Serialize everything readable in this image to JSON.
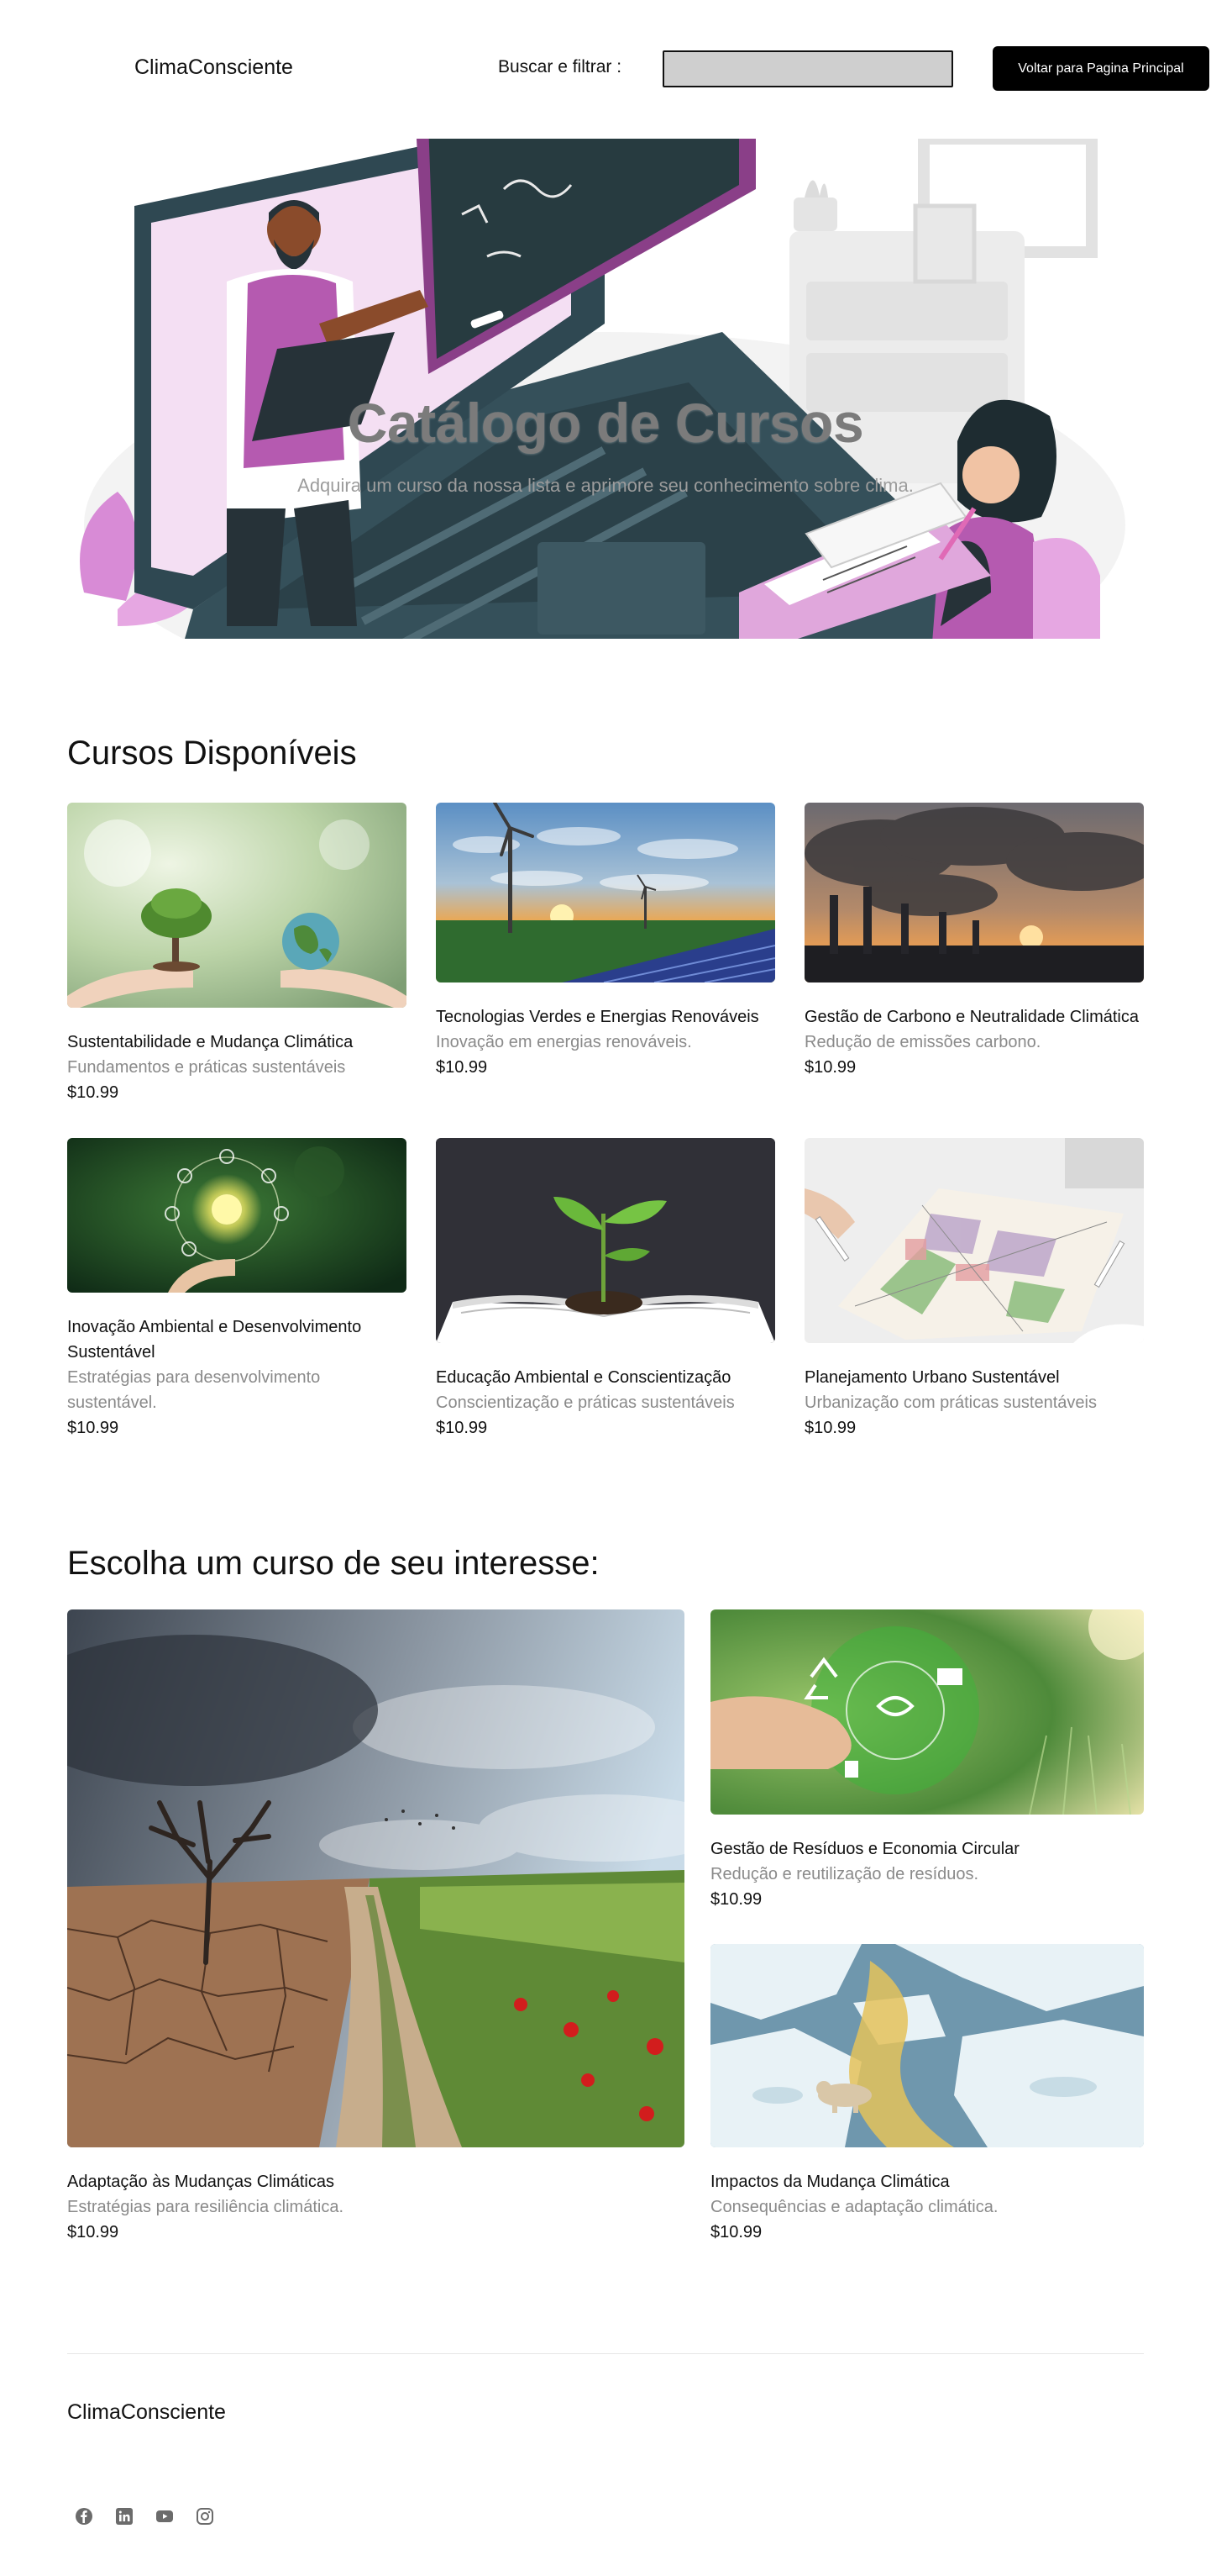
{
  "header": {
    "brand": "ClimaConsciente",
    "search_label": "Buscar e filtrar :",
    "search_value": "",
    "back_button": "Voltar para Pagina Principal"
  },
  "hero": {
    "title": "Catálogo de Cursos",
    "subtitle": "Adquira um curso da nossa lista e aprimore seu conhecimento sobre clima."
  },
  "available": {
    "heading": "Cursos Disponíveis",
    "courses": [
      {
        "title": "Sustentabilidade e Mudança Climática",
        "description": "Fundamentos e práticas sustentáveis",
        "price": "$10.99",
        "image": "hands-tree-globe"
      },
      {
        "title": "Tecnologias Verdes e Energias Renováveis",
        "description": "Inovação em energias renováveis.",
        "price": "$10.99",
        "image": "wind-solar-sunset"
      },
      {
        "title": "Gestão de Carbono e Neutralidade Climática",
        "description": "Redução de emissões carbono.",
        "price": "$10.99",
        "image": "factory-smoke"
      },
      {
        "title": "Inovação Ambiental e Desenvolvimento Sustentável",
        "description": "Estratégias para desenvolvimento sustentável.",
        "price": "$10.99",
        "image": "bulb-eco-icons"
      },
      {
        "title": "Educação Ambiental e Conscientização",
        "description": "Conscientização e práticas sustentáveis",
        "price": "$10.99",
        "image": "plant-on-book"
      },
      {
        "title": "Planejamento Urbano Sustentável",
        "description": "Urbanização com práticas sustentáveis",
        "price": "$10.99",
        "image": "urban-plan-map"
      }
    ]
  },
  "interest": {
    "heading": "Escolha um curso de seu interesse:",
    "courses": [
      {
        "title": "Adaptação às Mudanças Climáticas",
        "description": "Estratégias para resiliência climática.",
        "price": "$10.99",
        "image": "drought-vs-meadow"
      },
      {
        "title": "Gestão de Resíduos e Economia Circular",
        "description": "Redução e reutilização de resíduos.",
        "price": "$10.99",
        "image": "recycle-hands"
      },
      {
        "title": "Impactos da Mudança Climática",
        "description": "Consequências e adaptação climática.",
        "price": "$10.99",
        "image": "melting-ice-bear"
      }
    ]
  },
  "footer": {
    "brand": "ClimaConsciente",
    "social": [
      "facebook-icon",
      "linkedin-icon",
      "youtube-icon",
      "instagram-icon"
    ]
  },
  "colors": {
    "button_bg": "#000000",
    "search_bg": "#cfcfcf",
    "text_muted": "#8a8a8a",
    "hero_title": "#7b7b7b"
  }
}
